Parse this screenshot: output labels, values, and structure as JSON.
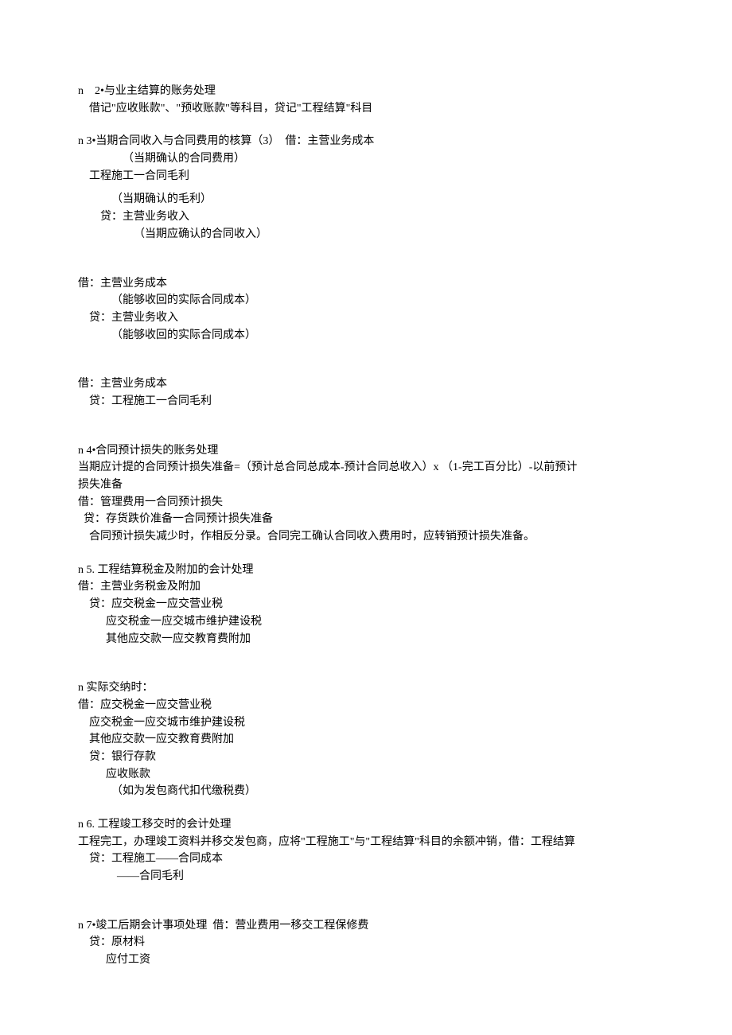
{
  "sections": [
    {
      "id": "2",
      "lines": [
        "n    2•与业主结算的账务处理",
        "    借记\"应收账款\"、\"预收账款\"等科目，贷记\"工程结算\"科目"
      ]
    },
    {
      "id": "3",
      "lines": [
        "n 3•当期合同收入与合同费用的核算（3）  借：主营业务成本",
        "                （当期确认的合同费用）",
        "    工程施工一合同毛利",
        "",
        "            （当期确认的毛利）",
        "        贷：主营业务收入",
        "                    （当期应确认的合同收入）"
      ]
    },
    {
      "id": "3b",
      "lines": [
        "借：主营业务成本",
        "            （能够收回的实际合同成本）",
        "    贷：主营业务收入",
        "            （能够收回的实际合同成本）"
      ]
    },
    {
      "id": "3c",
      "lines": [
        "借：主营业务成本",
        "    贷：工程施工一合同毛利"
      ]
    },
    {
      "id": "4",
      "lines": [
        "n 4•合同预计损失的账务处理",
        "当期应计提的合同预计损失准备=（预计总合同总成本-预计合同总收入）x （1-完工百分比）-以前预计",
        "损失准备",
        "借：管理费用一合同预计损失",
        "  贷：存货跌价准备一合同预计损失准备",
        "    合同预计损失减少时，作相反分录。合同完工确认合同收入费用时，应转销预计损失准备。"
      ]
    },
    {
      "id": "5",
      "lines": [
        "n 5. 工程结算税金及附加的会计处理",
        "借：主营业务税金及附加",
        "    贷：应交税金一应交营业税",
        "          应交税金一应交城市维护建设税",
        "          其他应交款一应交教育费附加"
      ]
    },
    {
      "id": "5b",
      "lines": [
        "n 实际交纳时：",
        "借：应交税金一应交营业税",
        "    应交税金一应交城市维护建设税",
        "    其他应交款一应交教育费附加",
        "    贷：银行存款",
        "          应收账款",
        "            （如为发包商代扣代缴税费）"
      ]
    },
    {
      "id": "6",
      "lines": [
        "n 6. 工程竣工移交时的会计处理",
        "工程完工，办理竣工资料并移交发包商，应将\"工程施工\"与\"工程结算\"科目的余额冲销，借：工程结算",
        "    贷：工程施工——合同成本",
        "              ——合同毛利"
      ]
    },
    {
      "id": "7",
      "lines": [
        "n 7•竣工后期会计事项处理  借：营业费用一移交工程保修费",
        "    贷：原材料",
        "          应付工资"
      ]
    }
  ]
}
